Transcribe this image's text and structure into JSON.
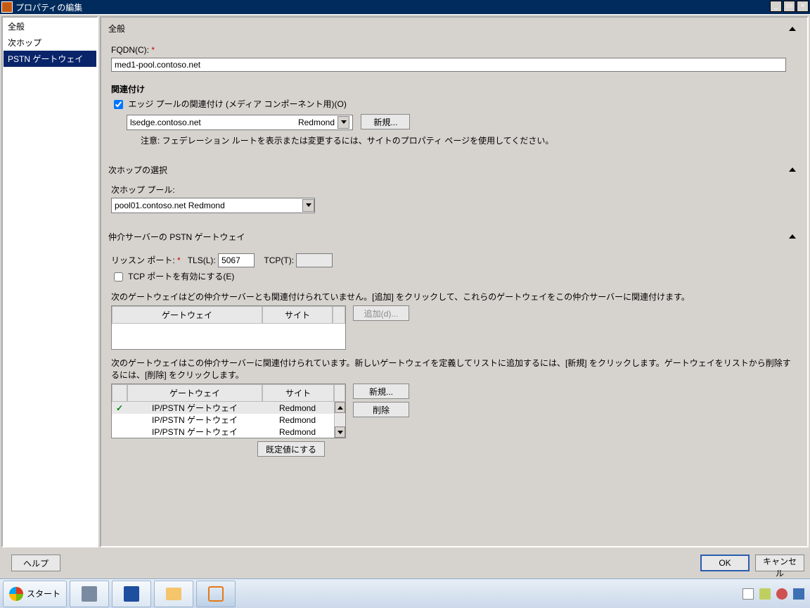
{
  "window": {
    "title": "プロパティの編集"
  },
  "sidebar": {
    "items": [
      {
        "label": "全般"
      },
      {
        "label": "次ホップ"
      },
      {
        "label": "PSTN ゲートウェイ"
      }
    ],
    "selected": 2
  },
  "sections": {
    "general": {
      "header": "全般",
      "fqdn_label": "FQDN(C):",
      "fqdn_value": "med1-pool.contoso.net",
      "assoc_header": "関連付け",
      "assoc_checkbox": "エッジ プールの関連付け (メディア コンポーネント用)(O)",
      "edge_pool_left": "lsedge.contoso.net",
      "edge_pool_right": "Redmond",
      "new_btn": "新規...",
      "note": "注意: フェデレーション ルートを表示または変更するには、サイトのプロパティ ページを使用してください。"
    },
    "nexthop": {
      "header": "次ホップの選択",
      "pool_label": "次ホップ プール:",
      "pool_value": "pool01.contoso.net   Redmond"
    },
    "pstn": {
      "header": "仲介サーバーの PSTN ゲートウェイ",
      "listen_label": "リッスン ポート:",
      "tls_label": "TLS(L):",
      "tls_value": "5067",
      "tcp_label": "TCP(T):",
      "tcp_value": "",
      "enable_tcp": "TCP ポートを有効にする(E)",
      "unassoc_desc": "次のゲートウェイはどの仲介サーバーとも関連付けられていません。[追加] をクリックして、これらのゲートウェイをこの仲介サーバーに関連付けます。",
      "col_gateway": "ゲートウェイ",
      "col_site": "サイト",
      "add_btn": "追加(d)...",
      "assoc_desc": "次のゲートウェイはこの仲介サーバーに関連付けられています。新しいゲートウェイを定義してリストに追加するには、[新規] をクリックします。ゲートウェイをリストから削除するには、[削除] をクリックします。",
      "assoc_rows": [
        {
          "default": true,
          "gateway": "IP/PSTN ゲートウェイ",
          "site": "Redmond"
        },
        {
          "default": false,
          "gateway": "IP/PSTN ゲートウェイ",
          "site": "Redmond"
        },
        {
          "default": false,
          "gateway": "IP/PSTN ゲートウェイ",
          "site": "Redmond"
        }
      ],
      "new_btn": "新規...",
      "delete_btn": "削除",
      "default_btn": "既定値にする"
    }
  },
  "actions": {
    "help": "ヘルプ",
    "ok": "OK",
    "cancel": "キャンセル"
  },
  "taskbar": {
    "start": "スタート"
  }
}
